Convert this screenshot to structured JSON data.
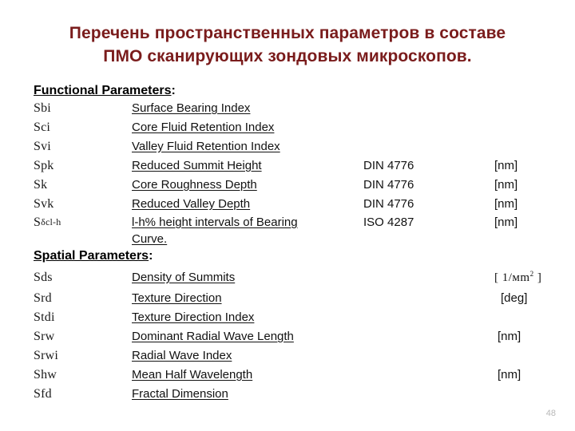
{
  "slide": {
    "title_line1": "Перечень  пространственных параметров в составе",
    "title_line2": "ПМО сканирующих зондовых микроскопов.",
    "title_color": "#7a1c1c",
    "page_number": "48"
  },
  "sections": [
    {
      "heading_underlined": "Functional Parameters",
      "heading_colon": ":",
      "rows": [
        {
          "symbol": "Sbi",
          "symbol_sub": "",
          "description": "Surface Bearing Index",
          "description_line2": "",
          "standard": "",
          "unit": ""
        },
        {
          "symbol": "Sci",
          "symbol_sub": "",
          "description": "Core Fluid Retention Index",
          "description_line2": "",
          "standard": "",
          "unit": ""
        },
        {
          "symbol": "Svi",
          "symbol_sub": "",
          "description": "Valley Fluid Retention Index",
          "description_line2": "",
          "standard": "",
          "unit": ""
        },
        {
          "symbol": "Spk",
          "symbol_sub": "",
          "description": "Reduced Summit Height",
          "description_line2": "",
          "standard": "DIN 4776",
          "unit": "[nm]"
        },
        {
          "symbol": "Sk",
          "symbol_sub": "",
          "description": "Core Roughness Depth",
          "description_line2": "",
          "standard": "DIN 4776",
          "unit": "[nm]"
        },
        {
          "symbol": "Svk",
          "symbol_sub": "",
          "description": "Reduced Valley Depth",
          "description_line2": "",
          "standard": "DIN 4776",
          "unit": "[nm]"
        },
        {
          "symbol": "S",
          "symbol_sub": "δcl-h",
          "description": "l-h% height intervals of Bearing",
          "description_line2": "Curve.",
          "standard": "ISO 4287",
          "unit": "[nm]"
        }
      ]
    },
    {
      "heading_underlined": "Spatial Parameters",
      "heading_colon": ":",
      "rows": [
        {
          "symbol": "Sds",
          "symbol_sub": "",
          "description": "Density of Summits",
          "description_line2": "",
          "standard": "",
          "unit": "[ 1/мm² ]"
        },
        {
          "symbol": "Srd",
          "symbol_sub": "",
          "description": "Texture Direction",
          "description_line2": "",
          "standard": "",
          "unit": "[deg]"
        },
        {
          "symbol": "Stdi",
          "symbol_sub": "",
          "description": "Texture Direction Index",
          "description_line2": "",
          "standard": "",
          "unit": ""
        },
        {
          "symbol": "Srw",
          "symbol_sub": "",
          "description": "Dominant Radial Wave Length",
          "description_line2": "",
          "standard": "",
          "unit": "[nm]"
        },
        {
          "symbol": "Srwi",
          "symbol_sub": "",
          "description": "Radial Wave Index",
          "description_line2": "",
          "standard": "",
          "unit": ""
        },
        {
          "symbol": "Shw",
          "symbol_sub": "",
          "description": "Mean Half Wavelength",
          "description_line2": "",
          "standard": "",
          "unit": "[nm]"
        },
        {
          "symbol": "Sfd",
          "symbol_sub": "",
          "description": "Fractal Dimension",
          "description_line2": "",
          "standard": "",
          "unit": ""
        }
      ]
    }
  ]
}
